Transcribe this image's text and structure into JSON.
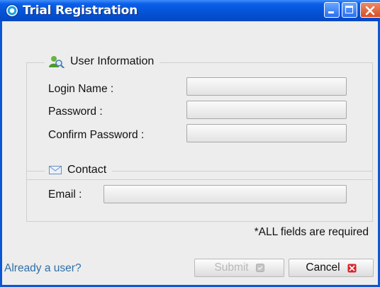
{
  "window": {
    "title": "Trial Registration"
  },
  "user_info": {
    "legend": "User Information",
    "login_label": "Login Name :",
    "login_value": "",
    "password_label": "Password :",
    "password_value": "",
    "confirm_label": "Confirm Password :",
    "confirm_value": ""
  },
  "contact": {
    "legend": "Contact",
    "email_label": "Email :",
    "email_value": ""
  },
  "note": "*ALL fields are required",
  "footer": {
    "already_link": "Already a user?",
    "submit_label": "Submit",
    "cancel_label": "Cancel"
  },
  "colors": {
    "titlebar": "#0452d5",
    "link": "#2e6ea6",
    "cancel_icon": "#d8232a"
  },
  "icons": {
    "app": "app-logo-icon",
    "user_info": "user-search-icon",
    "contact": "envelope-icon",
    "submit": "submit-icon",
    "cancel": "close-icon"
  }
}
